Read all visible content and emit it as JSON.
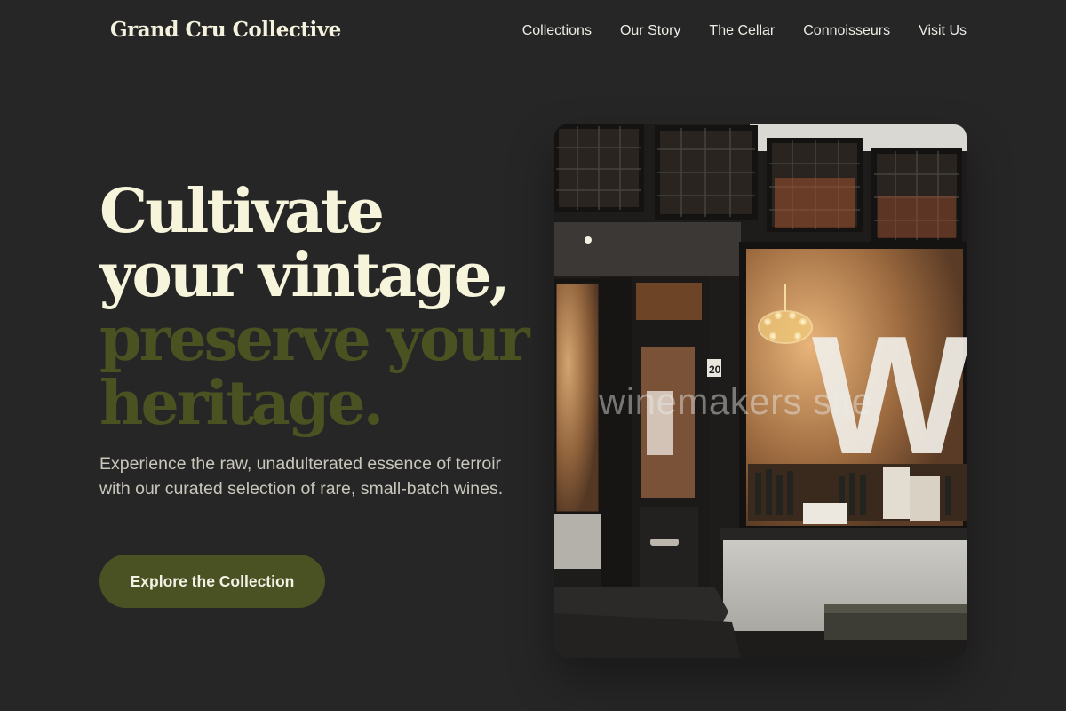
{
  "header": {
    "brand": "Grand Cru Collective",
    "nav": [
      "Collections",
      "Our Story",
      "The Cellar",
      "Connoisseurs",
      "Visit Us"
    ]
  },
  "hero": {
    "headline_light_1": "Cultivate",
    "headline_light_2": "your vintage,",
    "headline_dark_1": "preserve your",
    "headline_dark_2": "heritage.",
    "lede": "Experience the raw, unadulterated essence of terroir with our curated selection of rare, small-batch wines.",
    "cta": "Explore the Collection"
  },
  "photo": {
    "watermark": "winemakers site",
    "sign_text": "WIJ",
    "door_number": "20"
  },
  "colors": {
    "background": "#262626",
    "headline_light": "#f6f4db",
    "headline_accent": "#4b5221",
    "cta_background": "#4a5224"
  }
}
